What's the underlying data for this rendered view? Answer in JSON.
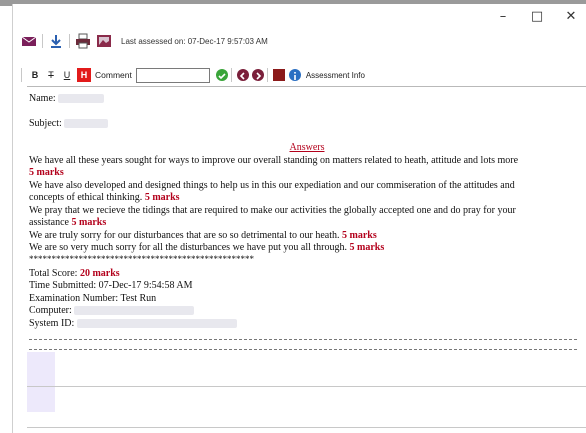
{
  "window": {
    "minimize_glyph": "–",
    "maximize_glyph": "□",
    "close_glyph": "✕"
  },
  "toolbar1": {
    "icons": [
      "mail-icon",
      "download-icon",
      "print-icon",
      "image-icon"
    ],
    "assessed_text": "Last assessed on: 07-Dec-17 9:57:03 AM"
  },
  "toolbar2": {
    "bold": "B",
    "strike": "T",
    "underline": "U",
    "highlight": "H",
    "comment_label": "Comment",
    "comment_value": "",
    "assessment_info": "Assessment Info",
    "colors": {
      "check": "#3aa53a",
      "nav": "#7a1f3a",
      "stop": "#8b1a1a",
      "info": "#2b6fc2",
      "highlight": "#e21b1b"
    }
  },
  "document": {
    "name_label": "Name:",
    "subject_label": "Subject:",
    "answers_title": "Answers",
    "answers": [
      {
        "text": "We have all these years sought for ways to improve our overall standing on matters related to heath, attitude and lots more",
        "marks": "5 marks"
      },
      {
        "text": "We have also developed and designed things to help us in this our expediation and our commiseration of the attitudes and",
        "text2": "concepts of ethical thinking.",
        "marks": "5 marks"
      },
      {
        "text": "We pray that we recieve the tidings that are required to make our activities the globally accepted one and do pray for your",
        "text2": "assistance",
        "marks": "5 marks"
      },
      {
        "text": "We are truly sorry for our disturbances that are so so detrimental to our heath.",
        "marks": "5 marks"
      },
      {
        "text": "We are so very much sorry for all the disturbances we have put you all through.",
        "marks": "5 marks"
      }
    ],
    "stars": "**************************************************",
    "total_label": "Total Score:",
    "total_value": "20 marks",
    "time_submitted": "Time Submitted: 07-Dec-17 9:54:58 AM",
    "exam_number": "Examination Number: Test Run",
    "computer_label": "Computer:",
    "system_label": "System ID:"
  }
}
